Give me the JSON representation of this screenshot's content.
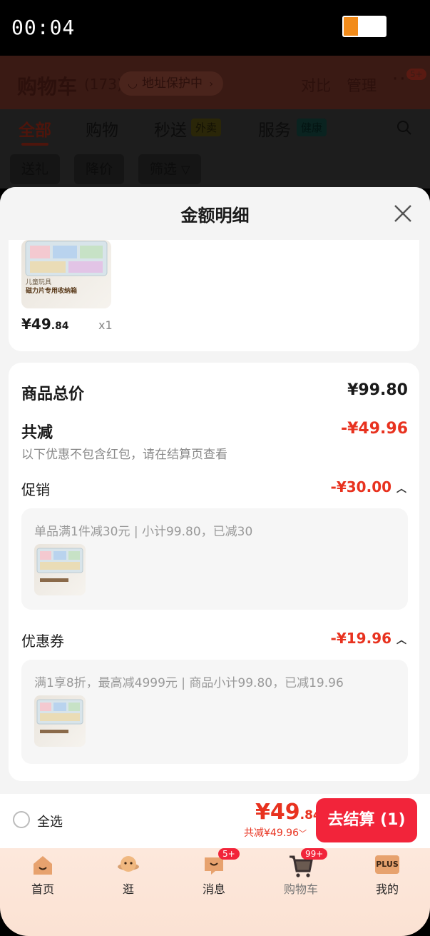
{
  "status_bar": {
    "time": "00:04",
    "battery_level": 0.35
  },
  "cart_header": {
    "title": "购物车",
    "count": "(173)",
    "address_protect": "地址保护中",
    "compare": "对比",
    "manage": "管理",
    "more_badge": "5+"
  },
  "tabs": [
    {
      "label": "全部"
    },
    {
      "label": "购物"
    },
    {
      "label": "秒送",
      "tag": "外卖"
    },
    {
      "label": "服务",
      "tag": "健康"
    }
  ],
  "filters": {
    "gift": "送礼",
    "price_drop": "降价",
    "filter": "筛选"
  },
  "sheet": {
    "title": "金额明细",
    "product": {
      "thumb_caption_1": "儿童玩具",
      "thumb_caption_2": "磁力片专用收纳箱",
      "price_int": "¥49",
      "price_dec": ".84",
      "qty": "x1"
    },
    "summary": {
      "total_label": "商品总价",
      "total_value": "¥99.80",
      "discount_label": "共减",
      "discount_value": "-¥49.96",
      "discount_hint": "以下优惠不包含红包，请在结算页查看",
      "promo_label": "促销",
      "promo_value": "-¥30.00",
      "promo_detail": "单品满1件减30元 | 小计99.80，已减30",
      "coupon_label": "优惠券",
      "coupon_value": "-¥19.96",
      "coupon_detail": "满1享8折，最高减4999元 | 商品小计99.80，已减19.96"
    }
  },
  "checkout": {
    "select_all": "全选",
    "price_int": "¥49",
    "price_dec": ".84",
    "saved": "共减¥49.96",
    "button": "去结算 (1)"
  },
  "bottom_nav": [
    {
      "label": "首页",
      "icon": "home-icon"
    },
    {
      "label": "逛",
      "icon": "browse-icon"
    },
    {
      "label": "消息",
      "icon": "message-icon",
      "badge": "5+"
    },
    {
      "label": "购物车",
      "icon": "cart-icon",
      "badge": "99+"
    },
    {
      "label": "我的",
      "icon": "plus-profile-icon",
      "icon_text": "PLUS"
    }
  ],
  "colors": {
    "accent": "#f2243a",
    "price_red": "#e8321f"
  }
}
